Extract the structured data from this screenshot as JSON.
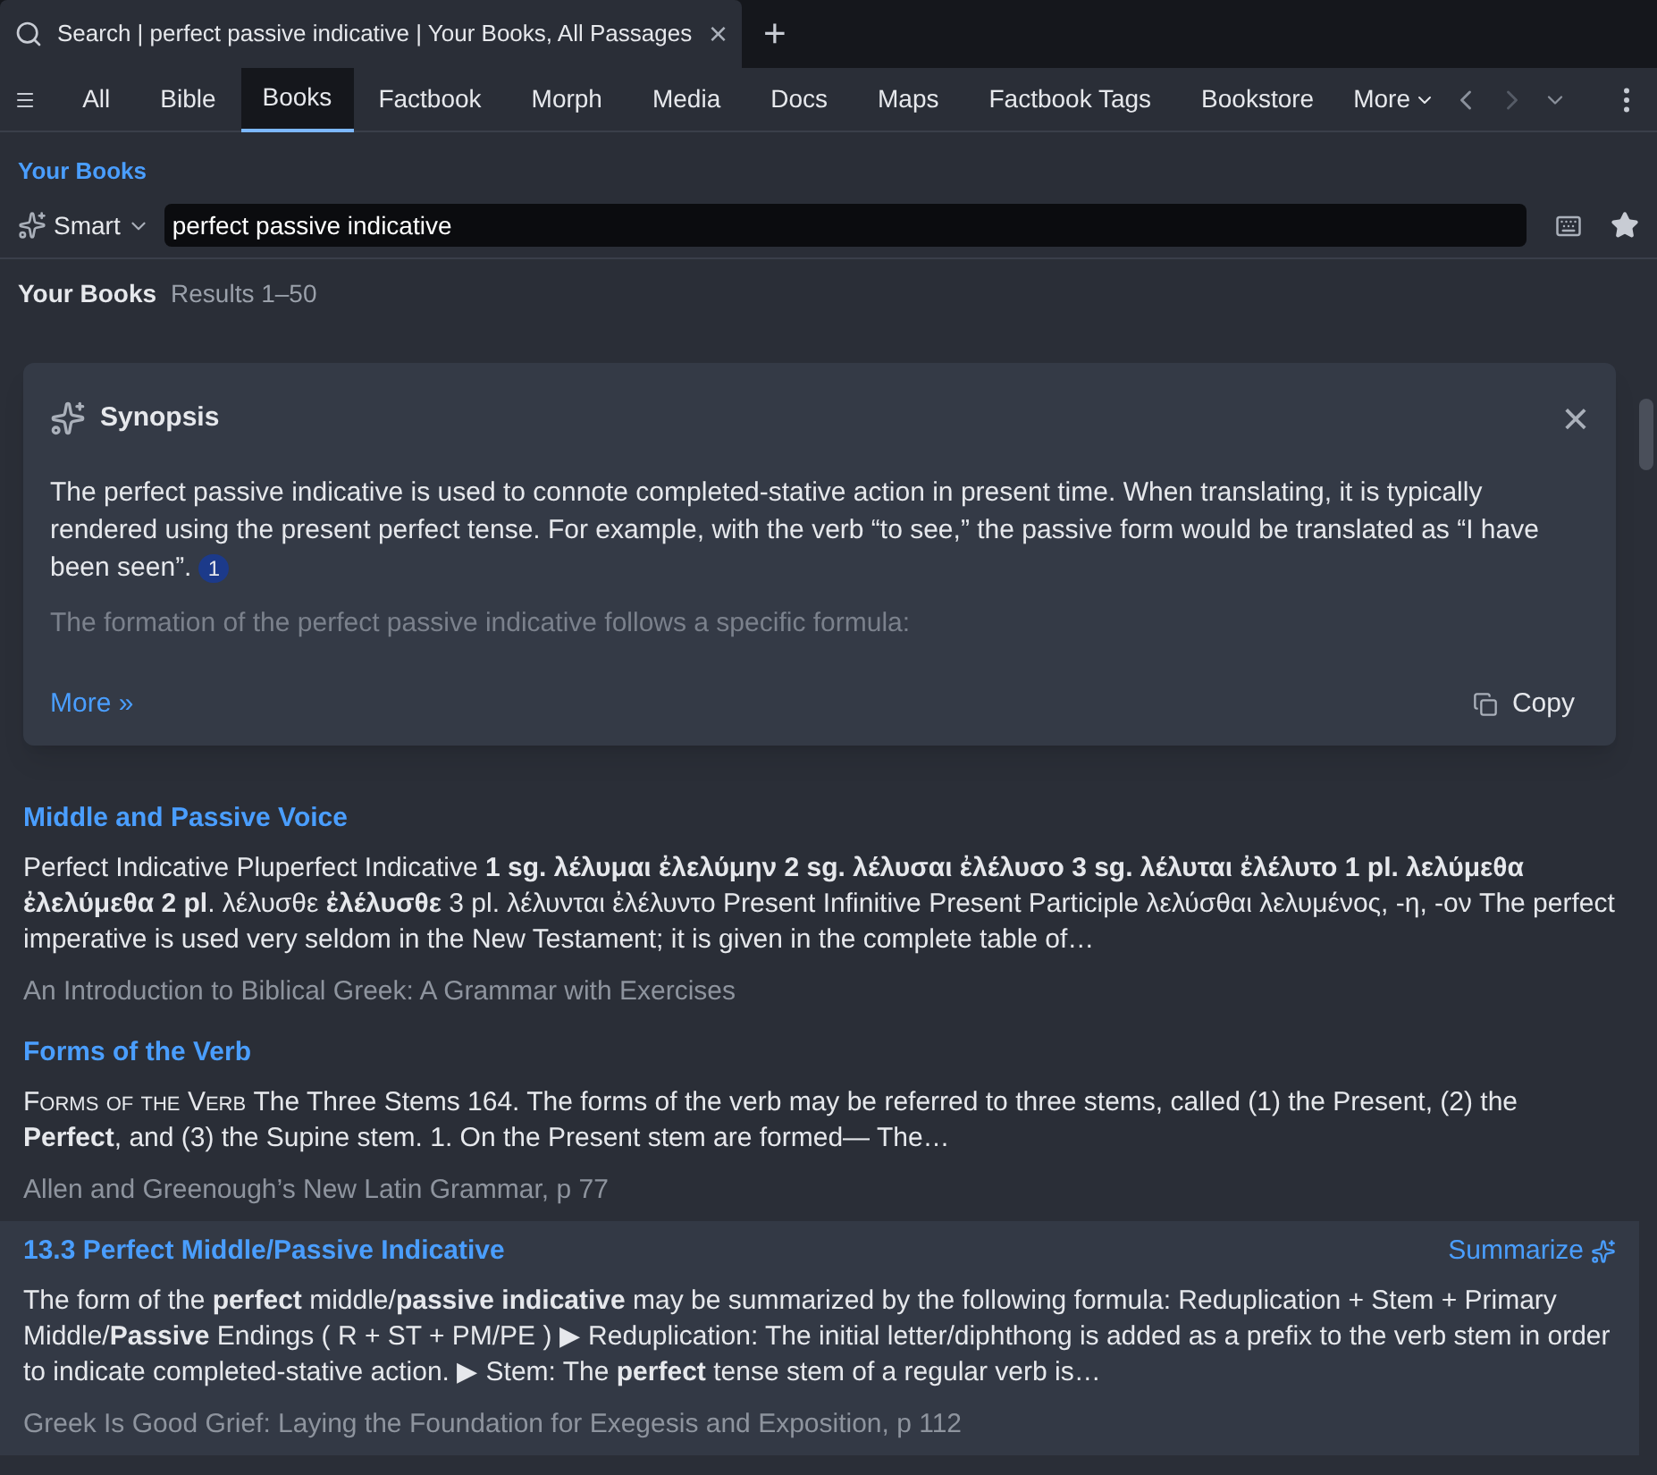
{
  "browser_tab": {
    "title": "Search | perfect passive indicative | Your Books, All Passages",
    "close": "×",
    "new_tab": "+"
  },
  "nav_tabs": [
    {
      "label": "All",
      "selected": false
    },
    {
      "label": "Bible",
      "selected": false
    },
    {
      "label": "Books",
      "selected": true
    },
    {
      "label": "Factbook",
      "selected": false
    },
    {
      "label": "Morph",
      "selected": false
    },
    {
      "label": "Media",
      "selected": false
    },
    {
      "label": "Docs",
      "selected": false
    },
    {
      "label": "Maps",
      "selected": false
    },
    {
      "label": "Factbook Tags",
      "selected": false
    },
    {
      "label": "Bookstore",
      "selected": false
    }
  ],
  "more": "More",
  "scope": "Your Books",
  "search": {
    "mode": "Smart",
    "value": "perfect passive indicative"
  },
  "results_header": {
    "title": "Your Books",
    "range": "Results 1–50"
  },
  "synopsis": {
    "title": "Synopsis",
    "close": "×",
    "text": "The perfect passive indicative is used to connote completed-stative action in present time. When translating, it is typically rendered using the present perfect tense. For example, with the verb “to see,” the passive form would be translated as “I have been seen”.",
    "citation": "1",
    "faded_text": "The formation of the perfect passive indicative follows a specific formula:",
    "more": "More »",
    "copy": "Copy"
  },
  "results": [
    {
      "title": "Middle and Passive Voice",
      "snippet": "Perfect Indicative Pluperfect Indicative **1 sg. λέλυμαι ἐλελύμην 2 sg. λέλυσαι ἐλέλυσο 3 sg. λέλυται ἐλέλυτο 1 pl. λελύμεθα ἐλελύμεθα 2 pl**. λέλυσθε **ἐλέλυσθε** 3 pl. λέλυνται ἐλέλυντο Present Infinitive Present Participle λελύσθαι λελυμένος, -η, -ον The perfect imperative is used very seldom in the New Testament; it is given in the complete table of…",
      "source": "An Introduction to Biblical Greek: A Grammar with Exercises",
      "hovered": false
    },
    {
      "title": "Forms of the Verb",
      "lead": "Forms of the Verb",
      "snippet": "The Three Stems 164. The forms of the verb may be referred to three stems, called (1) the Present, (2) the **Perfect**, and (3) the Supine stem. 1. On the Present stem are formed— The…",
      "source": "Allen and Greenough’s New Latin Grammar, p 77",
      "hovered": false
    },
    {
      "title": "13.3 Perfect Middle/Passive Indicative",
      "snippet": "The form of the **perfect** middle/**passive indicative** may be summarized by the following formula: Reduplication + Stem + Primary Middle/**Passive** Endings ( R + ST + PM/PE ) ▶ Reduplication: The initial letter/diphthong is added as a prefix to the verb stem in order to indicate completed-stative action. ▶ Stem: The **perfect** tense stem of a regular verb is…",
      "source": "Greek Is Good Grief: Laying the Foundation for Exegesis and Exposition, p 112",
      "hovered": true,
      "summarize": "Summarize"
    }
  ]
}
